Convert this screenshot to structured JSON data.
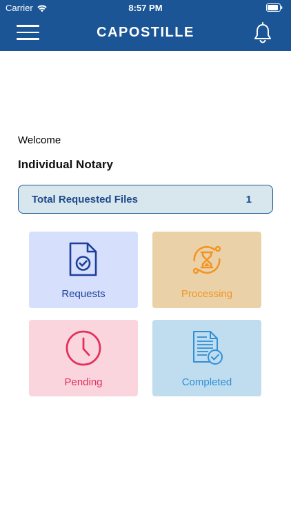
{
  "status_bar": {
    "carrier": "Carrier",
    "time": "8:57 PM"
  },
  "header": {
    "logo_text": "CAPOSTILLE",
    "menu_icon": "hamburger-menu-icon",
    "notification_icon": "bell-icon",
    "background_color": "#1c5596"
  },
  "main": {
    "welcome_text": "Welcome",
    "role_text": "Individual Notary",
    "total_files": {
      "label": "Total Requested Files",
      "count": "1"
    },
    "cards": [
      {
        "label": "Requests",
        "icon": "document-check-icon",
        "color": "#1d3f9a",
        "background": "#d6dffb"
      },
      {
        "label": "Processing",
        "icon": "hourglass-icon",
        "color": "#f29424",
        "background": "#ebd1a7"
      },
      {
        "label": "Pending",
        "icon": "clock-icon",
        "color": "#e2305a",
        "background": "#fad5dd"
      },
      {
        "label": "Completed",
        "icon": "document-completed-icon",
        "color": "#2f8fd6",
        "background": "#bfddee"
      }
    ]
  }
}
